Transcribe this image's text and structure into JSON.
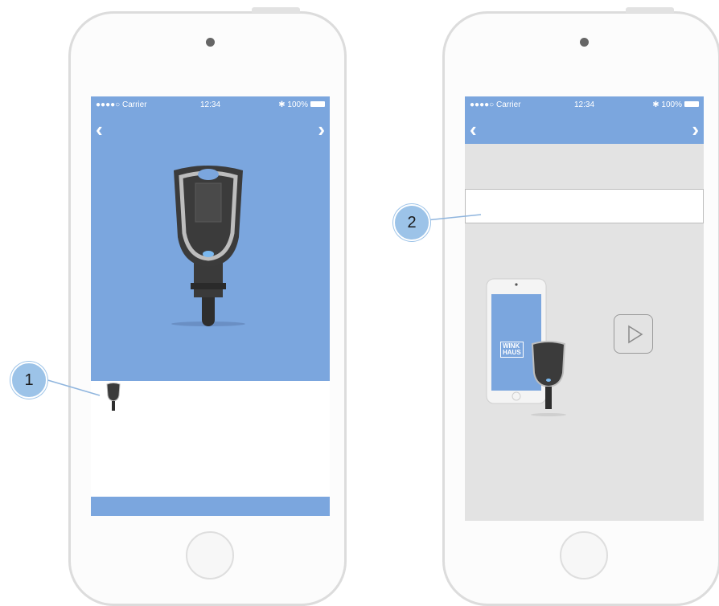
{
  "colors": {
    "header_blue": "#7ba6de",
    "content_gray": "#e3e3e3",
    "phone_frame": "#dcdcdc",
    "callout": "#9cc3e8"
  },
  "left_phone": {
    "status": {
      "carrier": "●●●●○ Carrier",
      "time": "12:34",
      "battery": "100%"
    },
    "nav": {
      "back_icon": "chevron-left-icon",
      "forward_icon": "chevron-right-icon"
    },
    "key_image": "winkhaus-key-illustration"
  },
  "right_phone": {
    "status": {
      "carrier": "●●●●○ Carrier",
      "time": "12:34",
      "battery": "100%"
    },
    "nav": {
      "back_icon": "chevron-left-icon",
      "forward_icon": "chevron-right-icon"
    },
    "illustration_logo": [
      "WINK",
      "HAUS"
    ],
    "play_icon": "play-icon"
  },
  "callouts": [
    "1",
    "2"
  ]
}
